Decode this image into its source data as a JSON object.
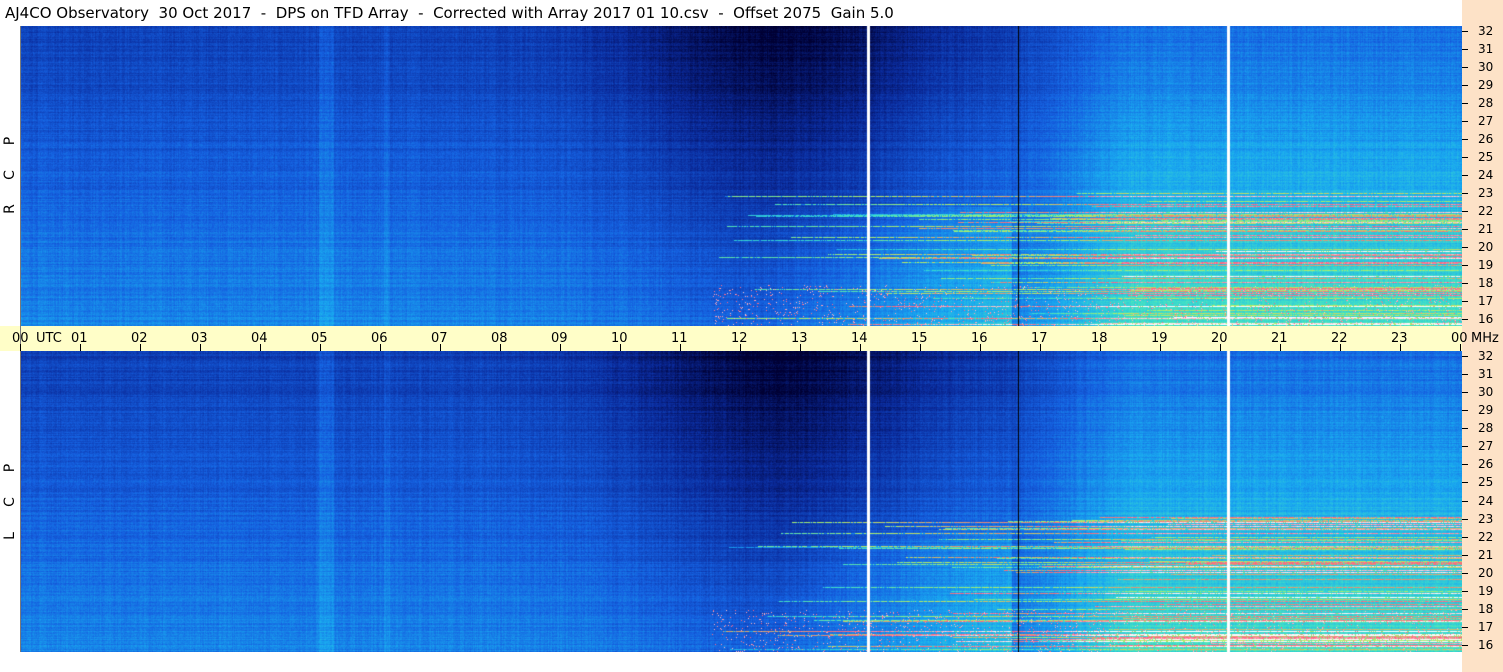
{
  "title": "AJ4CO Observatory  30 Oct 2017  -  DPS on TFD Array  -  Corrected with Array 2017 01 10.csv  -  Offset 2075  Gain 5.0",
  "panels": [
    {
      "id": "rcp",
      "letters": [
        "R",
        "C",
        "P"
      ]
    },
    {
      "id": "lcp",
      "letters": [
        "L",
        "C",
        "P"
      ]
    }
  ],
  "time_axis": {
    "labels": [
      "00",
      "01",
      "02",
      "03",
      "04",
      "05",
      "06",
      "07",
      "08",
      "09",
      "10",
      "11",
      "12",
      "13",
      "14",
      "15",
      "16",
      "17",
      "18",
      "19",
      "20",
      "21",
      "22",
      "23",
      "00"
    ],
    "utc_label": "UTC",
    "unit_label": "MHz"
  },
  "freq_axis": {
    "labels": [
      "32",
      "31",
      "30",
      "29",
      "28",
      "27",
      "26",
      "25",
      "24",
      "23",
      "22",
      "21",
      "20",
      "19",
      "18",
      "17",
      "16"
    ]
  },
  "chart_data": {
    "type": "heatmap",
    "title": "AJ4CO Observatory  30 Oct 2017  -  DPS on TFD Array  -  Corrected with Array 2017 01 10.csv  -  Offset 2075  Gain 5.0",
    "xlabel": "UTC",
    "ylabel": "MHz",
    "x_range_hours": [
      0,
      24
    ],
    "y_range_mhz": [
      16,
      32
    ],
    "panels": [
      "RCP",
      "LCP"
    ],
    "white_vertical_markers_utc_hours": [
      14.1,
      20.1
    ],
    "black_vertical_marker_utc_hours": 16.6,
    "colormap": [
      "#000033",
      "#0a2a9a",
      "#1560e0",
      "#19a8f0",
      "#3fe0c8",
      "#b8f060",
      "#ff6080",
      "#ffffff"
    ]
  }
}
